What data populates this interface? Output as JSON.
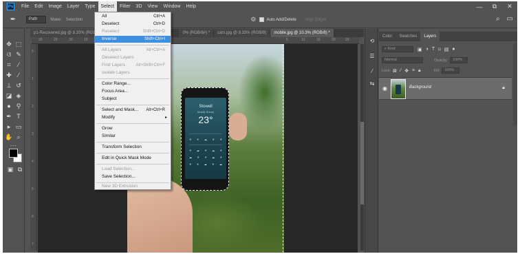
{
  "menubar": {
    "logo": "Ps",
    "items": [
      "File",
      "Edit",
      "Image",
      "Layer",
      "Type",
      "Select",
      "Filter",
      "3D",
      "View",
      "Window",
      "Help"
    ],
    "active": "Select",
    "window_controls": [
      "—",
      "⧉",
      "✕"
    ]
  },
  "options_bar": {
    "tool_icon": "pen-icon",
    "mode_value": "Path",
    "make_label": "Make:",
    "selection_label": "Selection",
    "auto_add_delete": "Auto Add/Delete",
    "align_edges": "Align Edges"
  },
  "doc_tabs": [
    {
      "label": "p1-Recovered.jpg @ 8.33% (RGB/8)",
      "active": false
    },
    {
      "label": "0% (RGB/8#) *",
      "active": false
    },
    {
      "label": "cars.jpg @ 8.33% (RGB/8)",
      "active": false
    },
    {
      "label": "mobile.jpg @ 10.3% (RGB/8) *",
      "active": true
    }
  ],
  "ruler_ticks": [
    "30",
    "25",
    "20",
    "15",
    "10",
    "5",
    "",
    "",
    "",
    "",
    "",
    "",
    "",
    "",
    "",
    "5",
    "10",
    "15",
    "20",
    "25",
    "30"
  ],
  "ruler_v_ticks": [
    "5",
    "1",
    "2",
    "3",
    "4",
    "5",
    "6",
    "7"
  ],
  "select_menu": {
    "items": [
      {
        "label": "All",
        "shortcut": "Ctrl+A",
        "disabled": false
      },
      {
        "label": "Deselect",
        "shortcut": "Ctrl+D",
        "disabled": false
      },
      {
        "label": "Reselect",
        "shortcut": "Shift+Ctrl+D",
        "disabled": true
      },
      {
        "label": "Inverse",
        "shortcut": "Shift+Ctrl+I",
        "disabled": false,
        "highlight": true
      },
      {
        "label": "All Layers",
        "shortcut": "Alt+Ctrl+A",
        "disabled": true
      },
      {
        "label": "Deselect Layers",
        "shortcut": "",
        "disabled": true
      },
      {
        "label": "Find Layers",
        "shortcut": "Alt+Shift+Ctrl+F",
        "disabled": true
      },
      {
        "label": "Isolate Layers",
        "shortcut": "",
        "disabled": true
      },
      {
        "label": "Color Range...",
        "shortcut": "",
        "disabled": false
      },
      {
        "label": "Focus Area...",
        "shortcut": "",
        "disabled": false
      },
      {
        "label": "Subject",
        "shortcut": "",
        "disabled": false
      },
      {
        "label": "Select and Mask...",
        "shortcut": "Alt+Ctrl+R",
        "disabled": false
      },
      {
        "label": "Modify",
        "shortcut": "",
        "disabled": false,
        "submenu": true
      },
      {
        "label": "Grow",
        "shortcut": "",
        "disabled": false
      },
      {
        "label": "Similar",
        "shortcut": "",
        "disabled": false
      },
      {
        "label": "Transform Selection",
        "shortcut": "",
        "disabled": false
      },
      {
        "label": "Edit in Quick Mask Mode",
        "shortcut": "",
        "disabled": false
      },
      {
        "label": "Load Selection...",
        "shortcut": "",
        "disabled": true
      },
      {
        "label": "Save Selection...",
        "shortcut": "",
        "disabled": false
      },
      {
        "label": "New 3D Extrusion",
        "shortcut": "",
        "disabled": true
      }
    ]
  },
  "phone_screen": {
    "city": "Stowell",
    "condition": "Mostly Sunny",
    "temperature": "23°"
  },
  "panels": {
    "tabs": [
      "Color",
      "Swatches",
      "Layers"
    ],
    "active_tab": "Layers",
    "kind_label": "Kind",
    "blend_mode": "Normal",
    "opacity_label": "Opacity:",
    "opacity_value": "100%",
    "lock_label": "Lock:",
    "fill_label": "Fill:",
    "fill_value": "100%",
    "layer_name": "Background"
  },
  "colors": {
    "ui_bg": "#535353",
    "menu_highlight": "#3f8fe0",
    "foreground": "#000000",
    "background": "#ffffff"
  }
}
